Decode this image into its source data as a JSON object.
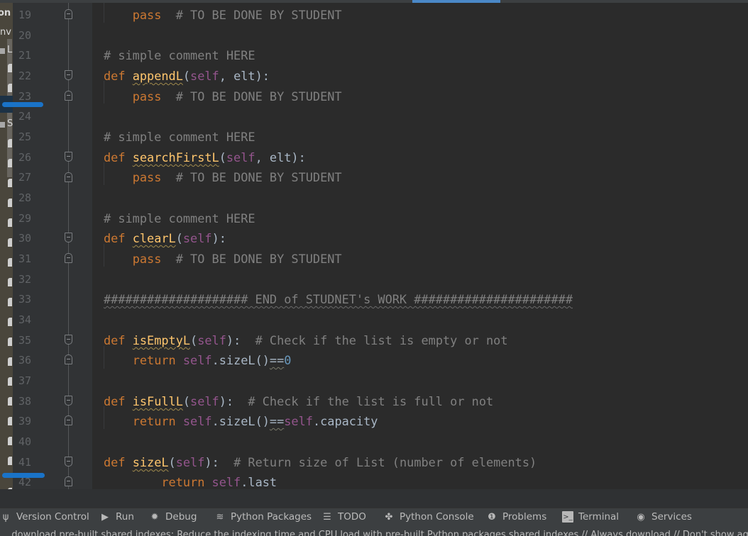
{
  "project_panel": {
    "labels": [
      "on",
      "env",
      "L",
      "S"
    ]
  },
  "editor": {
    "line_numbers": [
      "19",
      "20",
      "21",
      "22",
      "23",
      "24",
      "25",
      "26",
      "27",
      "28",
      "29",
      "30",
      "31",
      "32",
      "33",
      "34",
      "35",
      "36",
      "37",
      "38",
      "39",
      "40",
      "41",
      "42"
    ],
    "lines": {
      "l19": {
        "kw": "pass",
        "comment": "  # TO BE DONE BY STUDENT"
      },
      "l21": {
        "comment": "# simple comment HERE"
      },
      "l22": {
        "kw": "def ",
        "fn": "appendL",
        "open": "(",
        "self": "self",
        "rest": ", elt):"
      },
      "l23": {
        "kw": "pass",
        "comment": "  # TO BE DONE BY STUDENT"
      },
      "l25": {
        "comment": "# simple comment HERE"
      },
      "l26": {
        "kw": "def ",
        "fn": "searchFirstL",
        "open": "(",
        "self": "self",
        "rest": ", elt):"
      },
      "l27": {
        "kw": "pass",
        "comment": "  # TO BE DONE BY STUDENT"
      },
      "l29": {
        "comment": "# simple comment HERE"
      },
      "l30": {
        "kw": "def ",
        "fn": "clearL",
        "open": "(",
        "self": "self",
        "rest": "):"
      },
      "l31": {
        "kw": "pass",
        "comment": "  # TO BE DONE BY STUDENT"
      },
      "l33": {
        "text": "#################### END of STUDNET's WORK ######################"
      },
      "l35": {
        "kw": "def ",
        "fn": "isEmptyL",
        "open": "(",
        "self": "self",
        "rest": "):",
        "comment": "  # Check if the list is empty or not"
      },
      "l36": {
        "kw": "return ",
        "self": "self",
        "mid": ".sizeL()",
        "op": "==",
        "num": "0"
      },
      "l38": {
        "kw": "def ",
        "fn": "isFullL",
        "open": "(",
        "self": "self",
        "rest": "):",
        "comment": "  # Check if the list is full or not"
      },
      "l39": {
        "kw": "return ",
        "self": "self",
        "mid": ".sizeL()",
        "op": "==",
        "self2": "self",
        "tail": ".capacity"
      },
      "l41": {
        "kw": "def ",
        "fn": "sizeL",
        "open": "(",
        "self": "self",
        "rest": "):",
        "comment": "  # Return size of List (number of elements)"
      },
      "l42": {
        "kw": "return ",
        "self": "self",
        "tail": ".last"
      }
    }
  },
  "toolbar": {
    "items": [
      {
        "label": "Version Control",
        "icon": "version-control-icon"
      },
      {
        "label": "Run",
        "icon": "run-icon"
      },
      {
        "label": "Debug",
        "icon": "debug-icon"
      },
      {
        "label": "Python Packages",
        "icon": "python-packages-icon"
      },
      {
        "label": "TODO",
        "icon": "todo-icon"
      },
      {
        "label": "Python Console",
        "icon": "python-console-icon"
      },
      {
        "label": "Problems",
        "icon": "problems-icon"
      },
      {
        "label": "Terminal",
        "icon": "terminal-icon"
      },
      {
        "label": "Services",
        "icon": "services-icon"
      }
    ]
  },
  "status_bar": {
    "text": "...download pre-built shared indexes: Reduce the indexing time and CPU load with pre-built Python packages shared indexes // Always download // Don't show again"
  },
  "colors": {
    "accent": "#4a88c7",
    "pen_mark": "#1a73c8",
    "keyword": "#cc7832",
    "function": "#ffc66d",
    "self": "#94558d",
    "comment": "#808080",
    "number": "#6897bb"
  }
}
